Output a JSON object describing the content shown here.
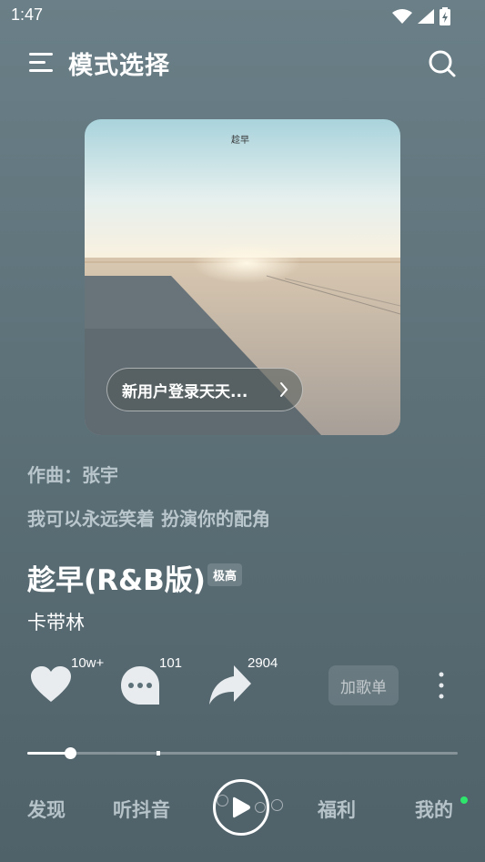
{
  "status_bar": {
    "time": "1:47"
  },
  "header": {
    "title": "模式选择"
  },
  "cover": {
    "tag": "趁早",
    "promo_text": "新用户登录天天..."
  },
  "lyrics": {
    "composer": "作曲：张宇",
    "line": "我可以永远笑着 扮演你的配角"
  },
  "song": {
    "title": "趁早(R&B版)",
    "quality": "极高",
    "artist": "卡带林"
  },
  "actions": {
    "like_count": "10w+",
    "comment_count": "101",
    "share_count": "2904",
    "add_playlist_label": "加歌单"
  },
  "progress": {
    "position": 0.1,
    "marker": 0.3
  },
  "nav": {
    "discover": "发现",
    "listen": "听抖音",
    "welfare": "福利",
    "mine": "我的"
  },
  "colors": {
    "accent_dot": "#2ee66b",
    "background": "#5d7179"
  }
}
